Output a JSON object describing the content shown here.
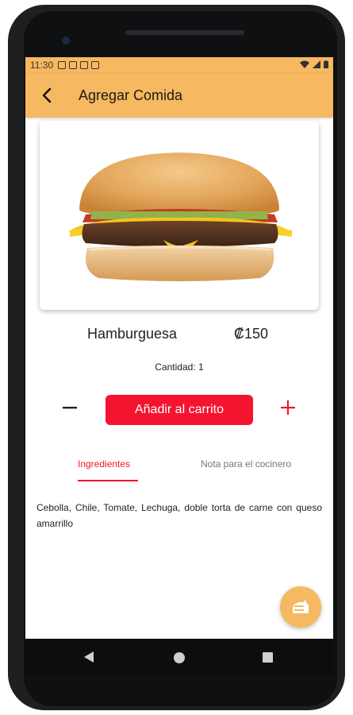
{
  "status": {
    "time": "11:30"
  },
  "appbar": {
    "title": "Agregar Comida"
  },
  "product": {
    "name": "Hamburguesa",
    "price": "₡150",
    "image_subject": "hamburger-image"
  },
  "quantity": {
    "label": "Cantidad: 1"
  },
  "actions": {
    "add_to_cart": "Añadir al carrito",
    "decrement_icon": "minus-icon",
    "increment_icon": "plus-icon"
  },
  "tabs": [
    {
      "label": "Ingredientes",
      "active": true
    },
    {
      "label": "Nota para el cocinero",
      "active": false
    }
  ],
  "ingredients": "Cebolla, Chile, Tomate, Lechuga, doble torta de carne con queso amarrillo",
  "fab": {
    "icon": "food-icon"
  },
  "colors": {
    "appbar": "#f6b860",
    "accent": "#f4142f"
  }
}
